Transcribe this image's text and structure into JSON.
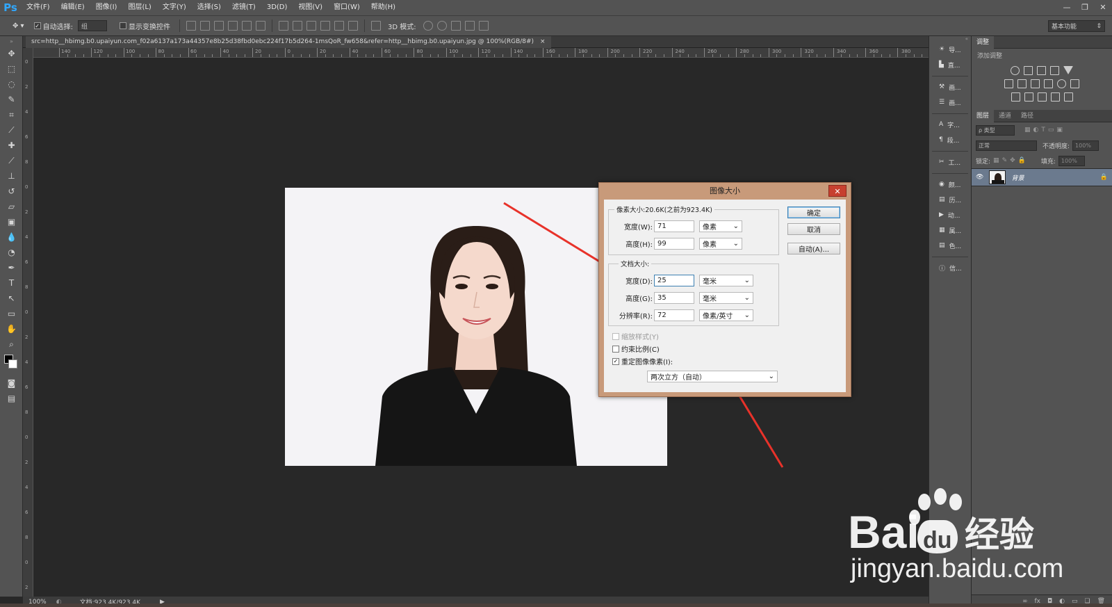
{
  "app": {
    "logo": "Ps"
  },
  "menu": [
    "文件(F)",
    "编辑(E)",
    "图像(I)",
    "图层(L)",
    "文字(Y)",
    "选择(S)",
    "滤镜(T)",
    "3D(D)",
    "视图(V)",
    "窗口(W)",
    "帮助(H)"
  ],
  "window_controls": {
    "minimize": "—",
    "restore": "❐",
    "close": "✕"
  },
  "options": {
    "auto_select_label": "自动选择:",
    "auto_select_value": "组",
    "show_transform_label": "显示变换控件",
    "mode_3d_label": "3D 模式:",
    "workspace": "基本功能"
  },
  "document": {
    "tab_title": "src=http__hbimg.b0.upaiyun.com_f02a6137a173a44357e8b25d38fbd0ebc224f17b5d264-1msQoR_fw658&refer=http__hbimg.b0.upaiyun.jpg @ 100%(RGB/8#)",
    "tab_close": "×",
    "zoom": "100%",
    "doc_size": "文档:923.4K/923.4K"
  },
  "ruler_h": [
    "140",
    "120",
    "100",
    "80",
    "60",
    "40",
    "20",
    "0",
    "20",
    "40",
    "60",
    "80",
    "100",
    "120",
    "140",
    "160",
    "180",
    "200",
    "220",
    "240",
    "260",
    "280",
    "300",
    "320",
    "340",
    "360",
    "380"
  ],
  "ruler_v": [
    "0",
    "2",
    "4",
    "6",
    "8",
    "0",
    "2",
    "4",
    "6",
    "8",
    "0",
    "2",
    "4",
    "6",
    "8",
    "0",
    "2",
    "4",
    "6",
    "8",
    "0",
    "2"
  ],
  "panel_strip": [
    "导...",
    "直...",
    "画...",
    "画...",
    "字...",
    "段...",
    "工...",
    "颜...",
    "历...",
    "动...",
    "属...",
    "色...",
    "信..."
  ],
  "adjustments": {
    "tab": "调整",
    "add_label": "添加调整"
  },
  "layers": {
    "tabs": [
      "图层",
      "通道",
      "路径"
    ],
    "kind_label": "ρ 类型",
    "blend_mode": "正常",
    "opacity_label": "不透明度:",
    "opacity_value": "100%",
    "lock_label": "锁定:",
    "fill_label": "填充:",
    "fill_value": "100%",
    "layer_name": "背景"
  },
  "dialog": {
    "title": "图像大小",
    "close": "✕",
    "pixel_size_legend": "像素大小:20.6K(之前为923.4K)",
    "width_label": "宽度(W):",
    "width_value": "71",
    "height_label": "高度(H):",
    "height_value": "99",
    "pixel_unit": "像素",
    "doc_size_legend": "文档大小:",
    "doc_width_label": "宽度(D):",
    "doc_width_value": "25",
    "doc_height_label": "高度(G):",
    "doc_height_value": "35",
    "resolution_label": "分辨率(R):",
    "resolution_value": "72",
    "mm_unit": "毫米",
    "res_unit": "像素/英寸",
    "ok": "确定",
    "cancel": "取消",
    "auto": "自动(A)...",
    "scale_styles": "缩放样式(Y)",
    "constrain": "约束比例(C)",
    "resample": "重定图像像素(I):",
    "resample_method": "两次立方（自动）"
  },
  "watermark": {
    "brand": "Bai",
    "brand2": "经验",
    "url": "jingyan.baidu.com"
  },
  "colors": {
    "arrow": "#e8322a",
    "accent": "#31a8ff",
    "dialog_frame": "#c89a7a",
    "baidu": "#ffffff"
  }
}
